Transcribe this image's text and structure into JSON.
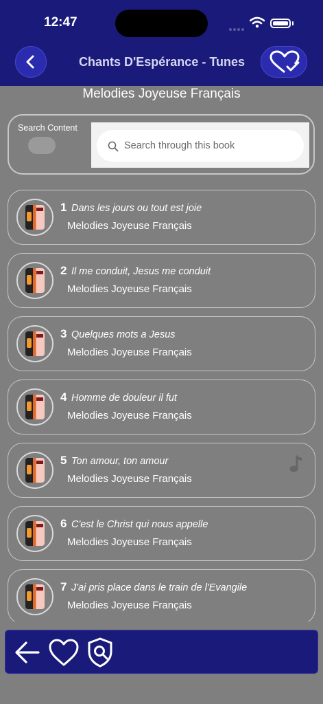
{
  "status": {
    "time": "12:47"
  },
  "navbar": {
    "title": "Chants D'Espérance - Tunes"
  },
  "book_title": "Melodies Joyeuse Français",
  "search": {
    "label": "Search Content",
    "placeholder": "Search through this book",
    "toggle_on": false
  },
  "songs": [
    {
      "number": "1",
      "title": "Dans les jours ou tout est joie",
      "book": "Melodies Joyeuse Français",
      "has_tune": false
    },
    {
      "number": "2",
      "title": "Il me conduit, Jesus me conduit",
      "book": "Melodies Joyeuse Français",
      "has_tune": false
    },
    {
      "number": "3",
      "title": "Quelques mots a Jesus",
      "book": "Melodies Joyeuse Français",
      "has_tune": false
    },
    {
      "number": "4",
      "title": "Homme de douleur il fut",
      "book": "Melodies Joyeuse Français",
      "has_tune": false
    },
    {
      "number": "5",
      "title": "Ton amour, ton amour",
      "book": "Melodies Joyeuse Français",
      "has_tune": true
    },
    {
      "number": "6",
      "title": "C'est le Christ qui nous appelle",
      "book": "Melodies Joyeuse Français",
      "has_tune": false
    },
    {
      "number": "7",
      "title": "J'ai pris place dans le train de l'Evangile",
      "book": "Melodies Joyeuse Français",
      "has_tune": false
    }
  ],
  "icons": {
    "back": "chevron-left-icon",
    "favorites": "heart-check-icon",
    "search": "search-icon",
    "music": "music-note-icon",
    "bottom": [
      "arrow-left-icon",
      "heart-icon",
      "shield-search-icon"
    ]
  },
  "colors": {
    "bar": "#1a1a7a",
    "button": "#2b2bb0",
    "background": "#7f7f7f"
  }
}
